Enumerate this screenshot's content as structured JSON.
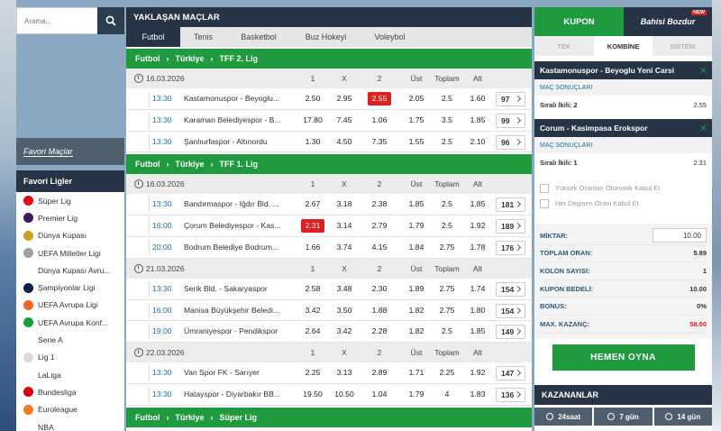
{
  "search": {
    "placeholder": "Arama..."
  },
  "sidebar": {
    "fav_matches": "Favori Maçlar",
    "fav_leagues_title": "Favori Ligler",
    "leagues": [
      {
        "label": "Süper Lig",
        "icon": "turkey-flag-icon",
        "color": "#e30a17"
      },
      {
        "label": "Premier Lig",
        "icon": "premier-league-icon",
        "color": "#3d195b"
      },
      {
        "label": "Dünya Kupası",
        "icon": "world-cup-trophy-icon",
        "color": "#c9a227"
      },
      {
        "label": "UEFA Milletler Ligi",
        "icon": "nations-league-icon",
        "color": "#9aa0a6"
      },
      {
        "label": "Dünya Kupası Avru...",
        "icon": "",
        "color": ""
      },
      {
        "label": "Şampiyonlar Ligi",
        "icon": "champions-league-icon",
        "color": "#0b1e48"
      },
      {
        "label": "UEFA Avrupa Ligi",
        "icon": "europa-league-icon",
        "color": "#f26522"
      },
      {
        "label": "UEFA Avrupa Konf...",
        "icon": "conference-league-icon",
        "color": "#19a03a"
      },
      {
        "label": "Serie A",
        "icon": "",
        "color": ""
      },
      {
        "label": "Lig 1",
        "icon": "ligue1-icon",
        "color": "#d9d9d9"
      },
      {
        "label": "LaLiga",
        "icon": "",
        "color": ""
      },
      {
        "label": "Bundesliga",
        "icon": "bundesliga-icon",
        "color": "#d20515"
      },
      {
        "label": "Euroleague",
        "icon": "euroleague-icon",
        "color": "#f47b20"
      },
      {
        "label": "NBA",
        "icon": "",
        "color": ""
      }
    ]
  },
  "main": {
    "title": "YAKLAŞAN MAÇLAR",
    "tabs": [
      "Futbol",
      "Tenis",
      "Basketbol",
      "Buz Hokeyi",
      "Voleybol"
    ],
    "cols": [
      "1",
      "X",
      "2",
      "Üst",
      "Toplam",
      "Alt"
    ],
    "sections": [
      {
        "crumbs": [
          "Futbol",
          "Türkiye",
          "TFF 2. Lig"
        ],
        "dates": [
          {
            "date": "16.03.2026",
            "matches": [
              {
                "time": "13:30",
                "name": "Kastamonuspor - Beyoglu...",
                "o1": "2.50",
                "ox": "2.95",
                "o2": "2.55",
                "ust": "2.05",
                "top": "2.5",
                "alt": "1.60",
                "more": "97",
                "hl": "o2"
              },
              {
                "time": "13:30",
                "name": "Karaman Belediyespor - B...",
                "o1": "17.80",
                "ox": "7.45",
                "o2": "1.06",
                "ust": "1.75",
                "top": "3.5",
                "alt": "1.85",
                "more": "99",
                "hl": ""
              },
              {
                "time": "13:30",
                "name": "Şanlıurfaspor - Altınordu",
                "o1": "1.30",
                "ox": "4.50",
                "o2": "7.35",
                "ust": "1.55",
                "top": "2.5",
                "alt": "2.10",
                "more": "96",
                "hl": ""
              }
            ]
          }
        ]
      },
      {
        "crumbs": [
          "Futbol",
          "Türkiye",
          "TFF 1. Lig"
        ],
        "dates": [
          {
            "date": "16.03.2026",
            "matches": [
              {
                "time": "13:30",
                "name": "Bandırmaspor - Iğdır Bld. ...",
                "o1": "2.67",
                "ox": "3.18",
                "o2": "2.38",
                "ust": "1.85",
                "top": "2.5",
                "alt": "1.85",
                "more": "181",
                "hl": ""
              },
              {
                "time": "16:00",
                "name": "Çorum Belediyespor - Kas...",
                "o1": "2.31",
                "ox": "3.14",
                "o2": "2.79",
                "ust": "1.79",
                "top": "2.5",
                "alt": "1.92",
                "more": "189",
                "hl": "o1"
              },
              {
                "time": "20:00",
                "name": "Bodrum Belediye Bodrum...",
                "o1": "1.66",
                "ox": "3.74",
                "o2": "4.15",
                "ust": "1.84",
                "top": "2.75",
                "alt": "1.78",
                "more": "176",
                "hl": ""
              }
            ]
          },
          {
            "date": "21.03.2026",
            "matches": [
              {
                "time": "13:30",
                "name": "Serik Bld. - Sakaryaspor",
                "o1": "2.58",
                "ox": "3.48",
                "o2": "2.30",
                "ust": "1.89",
                "top": "2.75",
                "alt": "1.74",
                "more": "154",
                "hl": ""
              },
              {
                "time": "16:00",
                "name": "Manisa Büyükşehir Beledi...",
                "o1": "3.42",
                "ox": "3.50",
                "o2": "1.88",
                "ust": "1.82",
                "top": "2.75",
                "alt": "1.80",
                "more": "154",
                "hl": ""
              },
              {
                "time": "19:00",
                "name": "Ümraniyespor - Pendikspor",
                "o1": "2.64",
                "ox": "3.42",
                "o2": "2.28",
                "ust": "1.82",
                "top": "2.5",
                "alt": "1.85",
                "more": "149",
                "hl": ""
              }
            ]
          },
          {
            "date": "22.03.2026",
            "matches": [
              {
                "time": "13:30",
                "name": "Van Spor FK - Sarıyer",
                "o1": "2.25",
                "ox": "3.13",
                "o2": "2.89",
                "ust": "1.71",
                "top": "2.25",
                "alt": "1.92",
                "more": "147",
                "hl": ""
              },
              {
                "time": "13:30",
                "name": "Hatayspor - Diyarbakır BB...",
                "o1": "19.50",
                "ox": "10.50",
                "o2": "1.04",
                "ust": "1.79",
                "top": "4",
                "alt": "1.83",
                "more": "136",
                "hl": ""
              }
            ]
          }
        ]
      },
      {
        "crumbs": [
          "Futbol",
          "Türkiye",
          "Süper Lig"
        ],
        "dates": []
      }
    ]
  },
  "coupon": {
    "title": "KUPON",
    "bahis": "Bahisi Bozdur",
    "new_badge": "NEW",
    "tabs": [
      "TEK",
      "KOMBİNE",
      "SİSTEM"
    ],
    "items": [
      {
        "match": "Kastamonuspor - Beyoglu Yeni Carsi",
        "market": "MAÇ SONUÇLARI",
        "selection": "Sıralı İkili: 2",
        "odd": "2.55"
      },
      {
        "match": "Corum - Kasimpasa Erokspor",
        "market": "MAÇ SONUÇLARI",
        "selection": "Sıralı İkili: 1",
        "odd": "2.31"
      }
    ],
    "options": [
      "Yüksek Oranları Otomatik Kabul Et",
      "Her Degisen Orani Kabul Et"
    ],
    "summary": {
      "amount_label": "MİKTAR:",
      "amount": "10.00",
      "total_odds_label": "TOPLAM ORAN:",
      "total_odds": "5.89",
      "count_label": "KOLON SAYISI:",
      "count": "1",
      "price_label": "KUPON BEDELİ:",
      "price": "10.00",
      "bonus_label": "BONUS:",
      "bonus": "0%",
      "max_label": "MAX. KAZANÇ:",
      "max": "58.90"
    },
    "play": "HEMEN OYNA",
    "winners_title": "KAZANANLAR",
    "winners_tabs": [
      "24saat",
      "7 gün",
      "14 gün"
    ]
  }
}
